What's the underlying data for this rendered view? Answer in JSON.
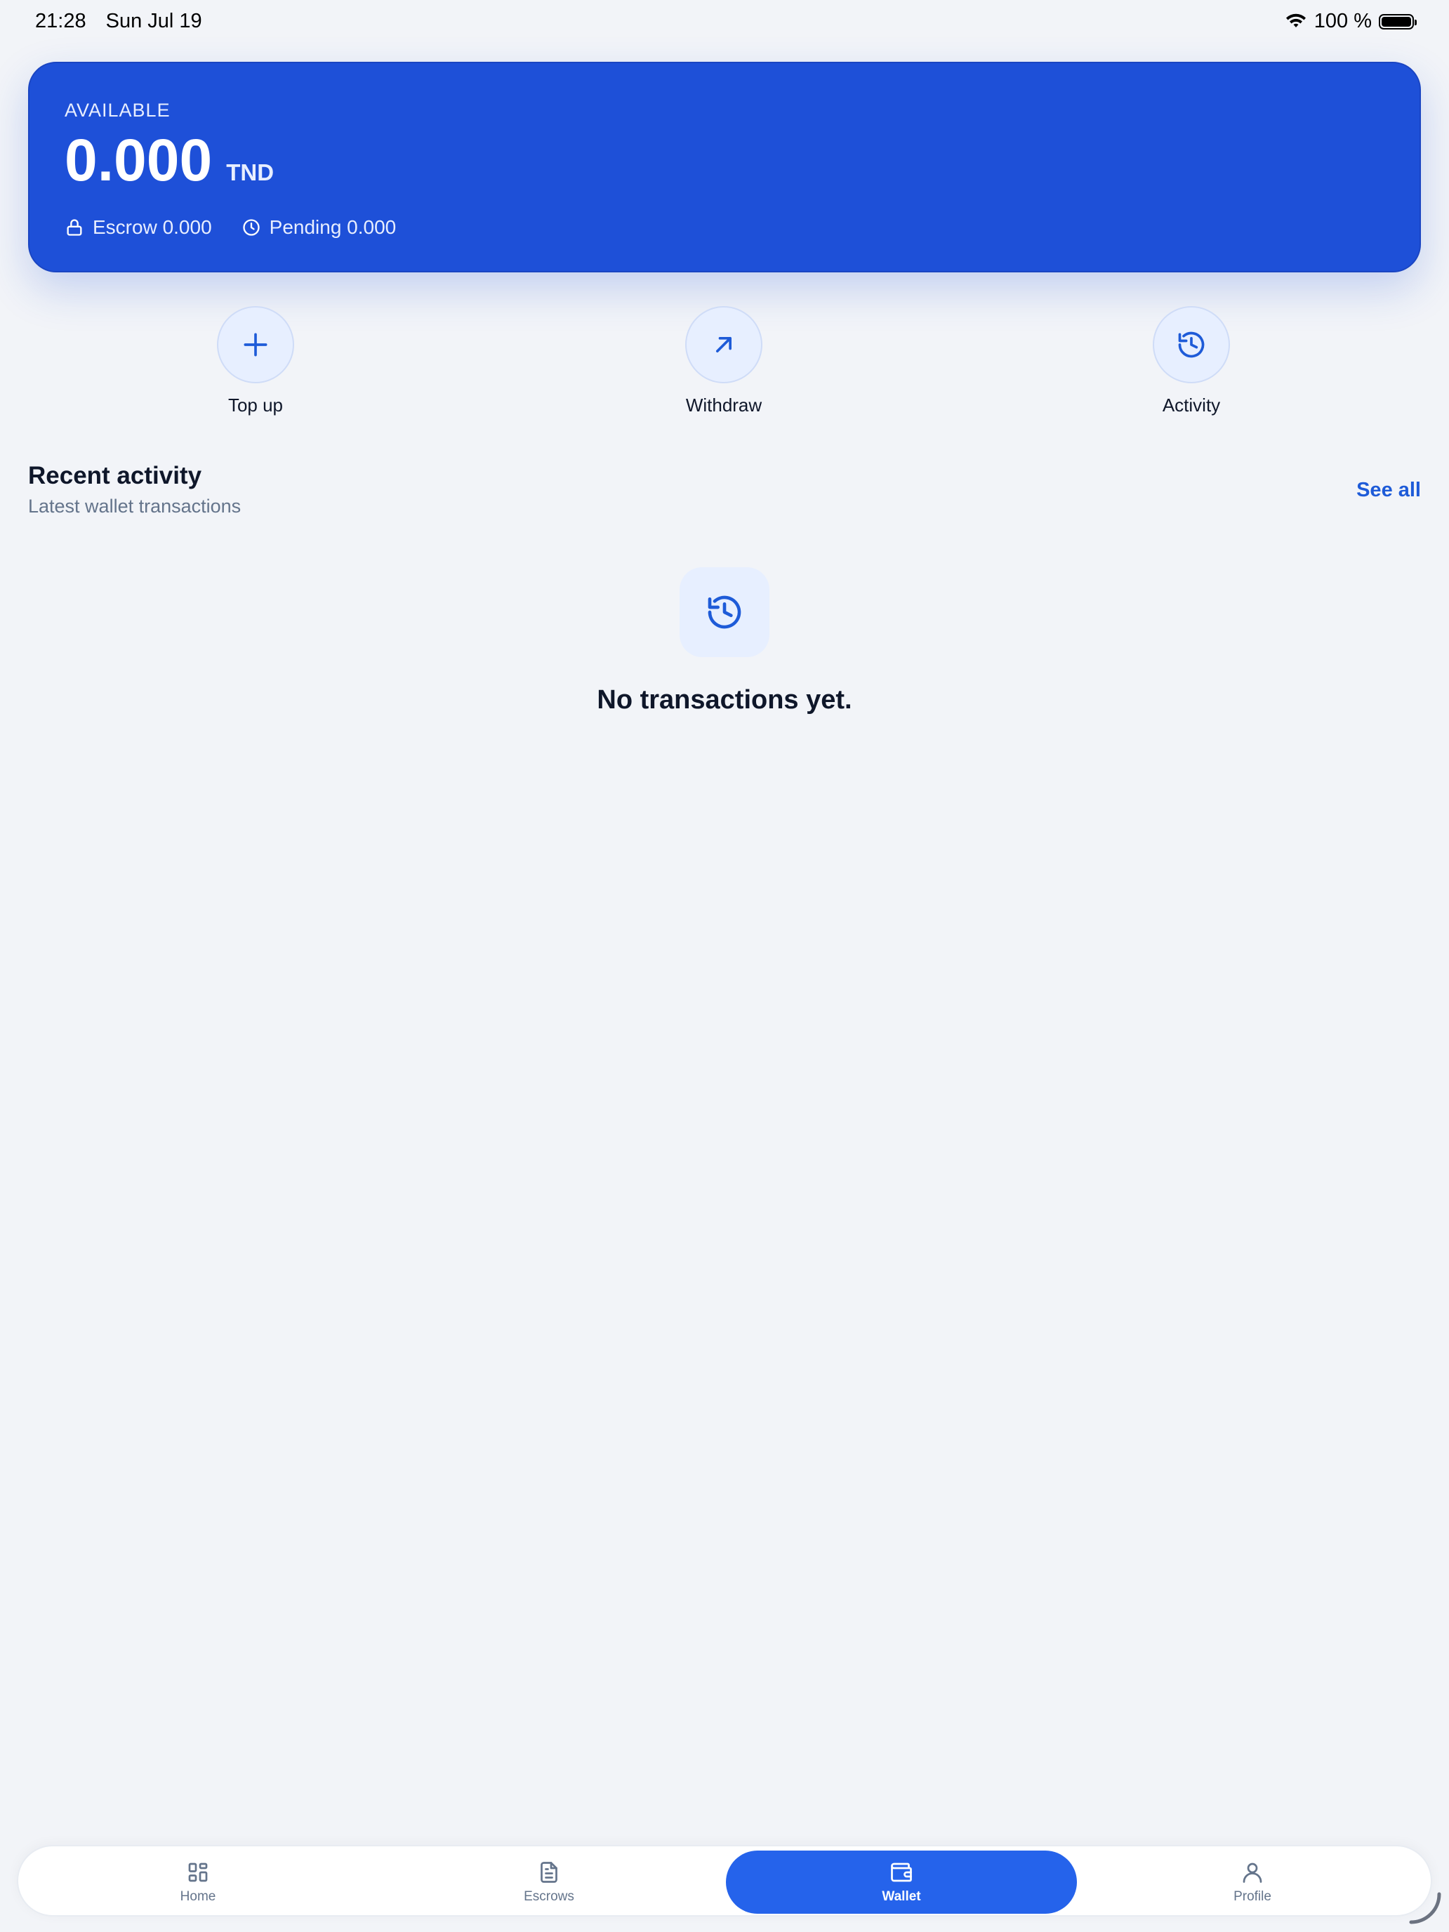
{
  "status_bar": {
    "time": "21:28",
    "date": "Sun Jul 19",
    "battery": "100 %",
    "icons": [
      "wifi-icon",
      "battery-icon"
    ]
  },
  "balance": {
    "label": "AVAILABLE",
    "amount": "0.000",
    "currency": "TND",
    "escrow": "Escrow 0.000",
    "pending": "Pending 0.000",
    "color": "#1e50d8"
  },
  "actions": [
    {
      "label": "Top up",
      "icon": "plus-icon"
    },
    {
      "label": "Withdraw",
      "icon": "arrow-up-right-icon"
    },
    {
      "label": "Activity",
      "icon": "history-icon"
    }
  ],
  "recent": {
    "title": "Recent activity",
    "subtitle": "Latest wallet transactions",
    "see_all": "See all",
    "empty_text": "No transactions yet.",
    "empty_icon": "history-icon"
  },
  "tabs": [
    {
      "label": "Home",
      "icon": "grid-icon",
      "active": false
    },
    {
      "label": "Escrows",
      "icon": "document-icon",
      "active": false
    },
    {
      "label": "Wallet",
      "icon": "wallet-icon",
      "active": true
    },
    {
      "label": "Profile",
      "icon": "user-icon",
      "active": false
    }
  ],
  "colors": {
    "accent": "#2563eb",
    "background": "#f2f4f8",
    "link": "#1e5bd8"
  }
}
